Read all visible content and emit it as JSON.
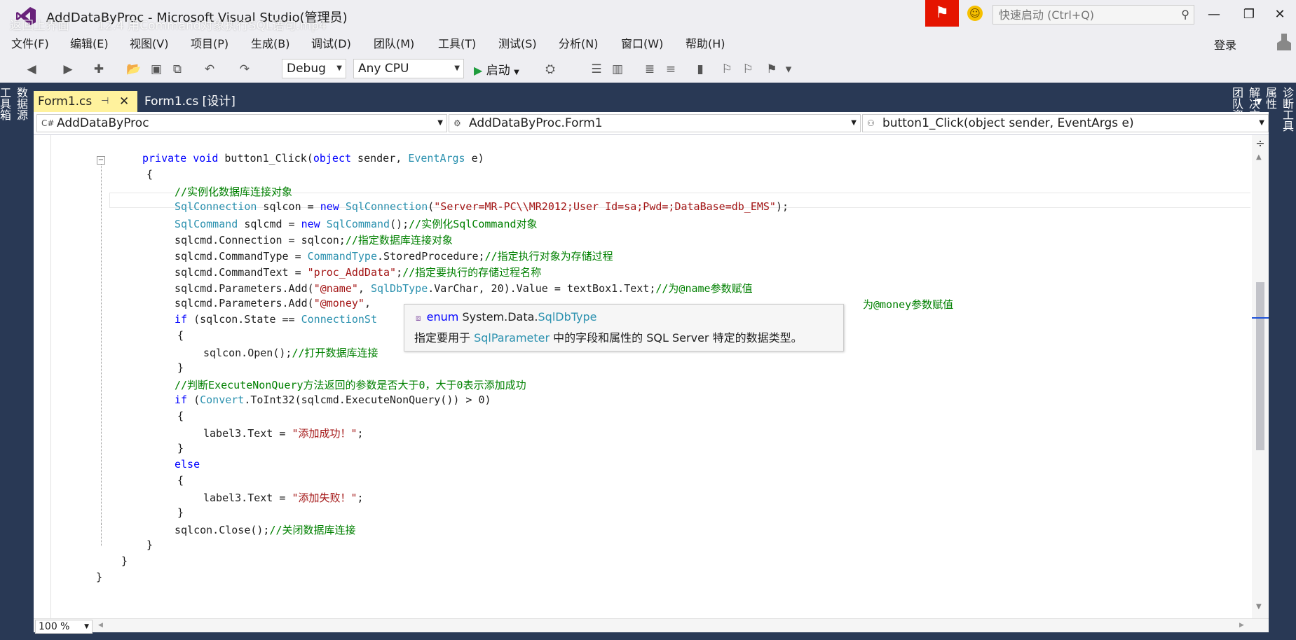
{
  "window": {
    "title": "AddDataByProc - Microsoft Visual Studio(管理员)",
    "overlay_back": "返回上界面",
    "overlay_video": "12.4  用Command对象执行SQL语句.mp4"
  },
  "quick_launch": {
    "placeholder": "快速启动 (Ctrl+Q)"
  },
  "menu": [
    {
      "label": "文件(F)"
    },
    {
      "label": "编辑(E)"
    },
    {
      "label": "视图(V)"
    },
    {
      "label": "项目(P)"
    },
    {
      "label": "生成(B)"
    },
    {
      "label": "调试(D)"
    },
    {
      "label": "团队(M)"
    },
    {
      "label": "工具(T)"
    },
    {
      "label": "测试(S)"
    },
    {
      "label": "分析(N)"
    },
    {
      "label": "窗口(W)"
    },
    {
      "label": "帮助(H)"
    }
  ],
  "login_label": "登录",
  "toolbar": {
    "config": "Debug",
    "platform": "Any CPU",
    "start_label": "启动"
  },
  "left_panels": [
    "数据源",
    "工具箱"
  ],
  "right_panels": [
    "诊断工具",
    "属性",
    "解决方案资源管理器",
    "团队资源管理器"
  ],
  "tabs": [
    {
      "label": "Form1.cs",
      "active": true
    },
    {
      "label": "Form1.cs [设计]",
      "active": false
    }
  ],
  "nav": {
    "project": "AddDataByProc",
    "type": "AddDataByProc.Form1",
    "member": "button1_Click(object sender, EventArgs e)"
  },
  "code": {
    "l1_a": "private void ",
    "l1_b": "button1_Click(",
    "l1_c": "object",
    "l1_d": " sender, ",
    "l1_e": "EventArgs",
    "l1_f": " e)",
    "l2": "{",
    "l3": "//实例化数据库连接对象",
    "l4_a": "SqlConnection",
    "l4_b": " sqlcon = ",
    "l4_c": "new",
    "l4_d": " ",
    "l4_e": "SqlConnection",
    "l4_f": "(",
    "l4_g": "\"Server=MR-PC\\\\MR2012;User Id=sa;Pwd=;DataBase=db_EMS\"",
    "l4_h": ");",
    "l5_a": "SqlCommand",
    "l5_b": " sqlcmd = ",
    "l5_c": "new",
    "l5_d": " ",
    "l5_e": "SqlCommand",
    "l5_f": "();",
    "l5_g": "//实例化SqlCommand对象",
    "l6_a": "sqlcmd.Connection = sqlcon;",
    "l6_b": "//指定数据库连接对象",
    "l7_a": "sqlcmd.CommandType = ",
    "l7_b": "CommandType",
    "l7_c": ".StoredProcedure;",
    "l7_d": "//指定执行对象为存储过程",
    "l8_a": "sqlcmd.CommandText = ",
    "l8_b": "\"proc_AddData\"",
    "l8_c": ";",
    "l8_d": "//指定要执行的存储过程名称",
    "l9_a": "sqlcmd.Parameters.Add(",
    "l9_b": "\"@name\"",
    "l9_c": ", ",
    "l9_d": "SqlDbType",
    "l9_e": ".VarChar, 20).Value = textBox1.Text;",
    "l9_f": "//为@name参数赋值",
    "l10_a": "sqlcmd.Parameters.Add(",
    "l10_b": "\"@money\"",
    "l10_c": ",",
    "l10_d": "为@money参数赋值",
    "l11_a": "if",
    "l11_b": " (sqlcon.State == ",
    "l11_c": "ConnectionSt",
    "l12": "{",
    "l13_a": "sqlcon.Open();",
    "l13_b": "//打开数据库连接",
    "l14": "}",
    "l15": "//判断ExecuteNonQuery方法返回的参数是否大于0，大于0表示添加成功",
    "l16_a": "if",
    "l16_b": " (",
    "l16_c": "Convert",
    "l16_d": ".ToInt32(sqlcmd.ExecuteNonQuery()) > 0)",
    "l17": "{",
    "l18_a": "label3.Text = ",
    "l18_b": "\"添加成功！\"",
    "l18_c": ";",
    "l19": "}",
    "l20": "else",
    "l21": "{",
    "l22_a": "label3.Text = ",
    "l22_b": "\"添加失败！\"",
    "l22_c": ";",
    "l23": "}",
    "l24_a": "sqlcon.Close();",
    "l24_b": "//关闭数据库连接",
    "l25": "}",
    "l26": "}",
    "l27": "}"
  },
  "tooltip": {
    "kw": "enum",
    "ns": "System.Data.",
    "type": "SqlDbType",
    "desc_a": "指定要用于 ",
    "desc_link": "SqlParameter",
    "desc_b": " 中的字段和属性的 SQL Server 特定的数据类型。"
  },
  "zoom": "100 %",
  "colors": {
    "accent": "#293955",
    "keyword": "#0000ff",
    "type": "#2b91af",
    "comment": "#008000",
    "string": "#a31515",
    "active_tab": "#fff29d"
  }
}
